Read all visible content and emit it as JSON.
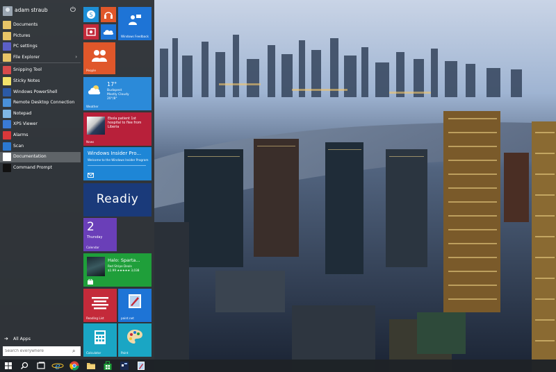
{
  "user": {
    "name": "adam straub"
  },
  "menu": {
    "items": [
      {
        "label": "Documents",
        "icon": "folder-icon",
        "color": "#e8c567",
        "has_arrow": false,
        "selected": false
      },
      {
        "label": "Pictures",
        "icon": "pictures-folder-icon",
        "color": "#e8c567",
        "has_arrow": false,
        "selected": false
      },
      {
        "label": "PC settings",
        "icon": "gear-icon",
        "color": "#5b5fc7",
        "has_arrow": false,
        "selected": false
      },
      {
        "label": "File Explorer",
        "icon": "file-explorer-icon",
        "color": "#e8c567",
        "has_arrow": true,
        "selected": false
      },
      {
        "label": "Snipping Tool",
        "icon": "snipping-tool-icon",
        "color": "#d84b4b",
        "has_arrow": false,
        "selected": false
      },
      {
        "label": "Sticky Notes",
        "icon": "sticky-notes-icon",
        "color": "#f2e36b",
        "has_arrow": false,
        "selected": false
      },
      {
        "label": "Windows PowerShell",
        "icon": "powershell-icon",
        "color": "#2b5aa6",
        "has_arrow": false,
        "selected": false
      },
      {
        "label": "Remote Desktop Connection",
        "icon": "remote-desktop-icon",
        "color": "#4a90d9",
        "has_arrow": false,
        "selected": false
      },
      {
        "label": "Notepad",
        "icon": "notepad-icon",
        "color": "#7fb7e6",
        "has_arrow": false,
        "selected": false
      },
      {
        "label": "XPS Viewer",
        "icon": "xps-viewer-icon",
        "color": "#3a7bd5",
        "has_arrow": false,
        "selected": false
      },
      {
        "label": "Alarms",
        "icon": "alarm-clock-icon",
        "color": "#d9383a",
        "has_arrow": false,
        "selected": false
      },
      {
        "label": "Scan",
        "icon": "scan-icon",
        "color": "#2b79d1",
        "has_arrow": false,
        "selected": false
      },
      {
        "label": "Documentation",
        "icon": "documentation-icon",
        "color": "#ffffff",
        "has_arrow": false,
        "selected": true
      },
      {
        "label": "Command Prompt",
        "icon": "command-prompt-icon",
        "color": "#111111",
        "has_arrow": false,
        "selected": false
      }
    ]
  },
  "all_apps": {
    "label": "All Apps"
  },
  "search": {
    "placeholder": "Search everywhere"
  },
  "tiles": {
    "windows_feedback": {
      "label": "Windows Feedback",
      "color": "#1e74d6"
    },
    "skype": {
      "color": "#1e8fd6"
    },
    "music": {
      "color": "#e0572a"
    },
    "video": {
      "color": "#c42a3a"
    },
    "onedrive": {
      "color": "#1e74d6"
    },
    "people": {
      "label": "People",
      "color": "#e0572a"
    },
    "weather": {
      "label": "Weather",
      "temp": "17°",
      "city": "Budapest",
      "condition": "Mostly Cloudy",
      "range": "20°/8°",
      "color": "#2b8ad9"
    },
    "news": {
      "label": "News",
      "headline": "Ebola patient 1st hospital to flee from Liberia",
      "color": "#b8203a"
    },
    "windows_insider": {
      "title": "Windows Insider Pro...",
      "subtitle": "Welcome to the Windows Insider Program",
      "color": "#1e86d6"
    },
    "readiy": {
      "text": "Readiy",
      "color": "#1a3a7a"
    },
    "calendar": {
      "label": "Calendar",
      "day_num": "2",
      "day_name": "Thursday",
      "color": "#6a3fb8"
    },
    "halo": {
      "title": "Halo: Sparta...",
      "deal": "Red Stripe Deals",
      "price": "$1.99 ★★★★★ 3,038",
      "color": "#1f9f3a"
    },
    "reading_list": {
      "label": "Reading List",
      "color": "#c42a3a"
    },
    "paint": {
      "label": "paint.net",
      "color": "#1e74d6"
    },
    "calculator": {
      "label": "Calculator",
      "color": "#1aa6c4"
    },
    "fresh_paint": {
      "label": "Paint",
      "color": "#1aa6c4"
    }
  },
  "taskbar": {
    "items": [
      "start-button",
      "search-button",
      "task-view-button",
      "internet-explorer",
      "chrome",
      "file-explorer",
      "store",
      "app-tile",
      "paint-app"
    ]
  }
}
